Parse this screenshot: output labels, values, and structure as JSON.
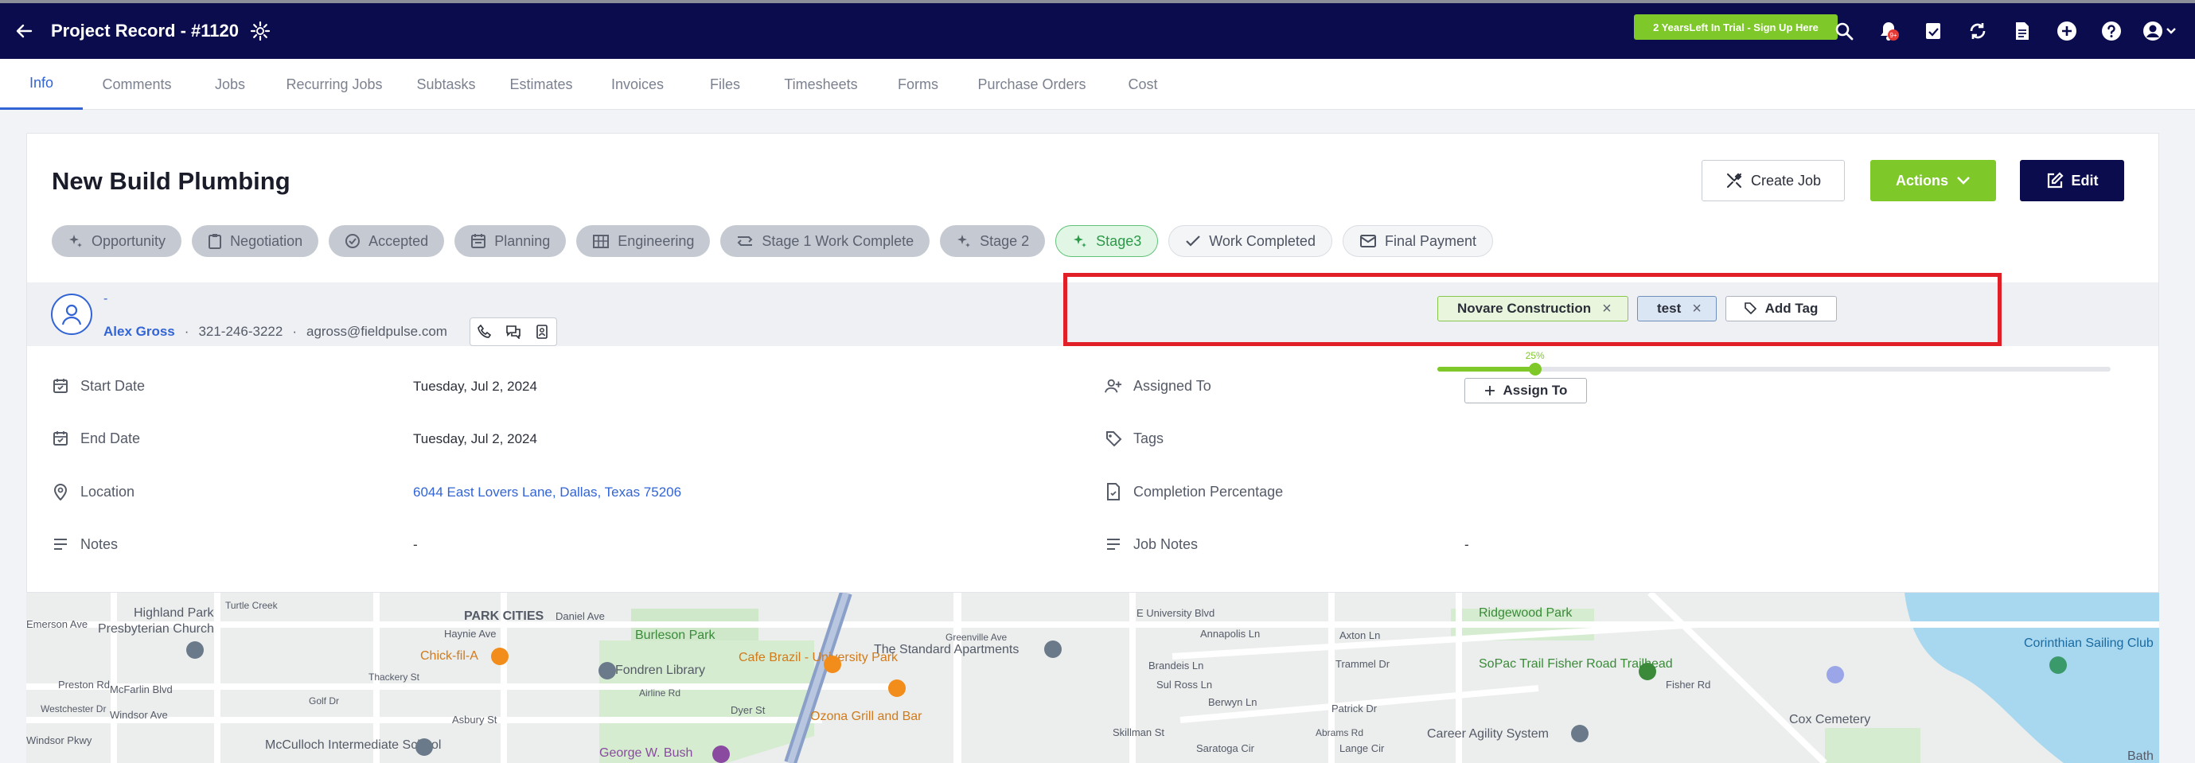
{
  "header": {
    "title": "Project Record - #1120",
    "trial_label": "2 YearsLeft In Trial - Sign Up Here",
    "notification_count": "9+"
  },
  "tabs": [
    {
      "label": "Info"
    },
    {
      "label": "Comments"
    },
    {
      "label": "Jobs"
    },
    {
      "label": "Recurring Jobs"
    },
    {
      "label": "Subtasks"
    },
    {
      "label": "Estimates"
    },
    {
      "label": "Invoices"
    },
    {
      "label": "Files"
    },
    {
      "label": "Timesheets"
    },
    {
      "label": "Forms"
    },
    {
      "label": "Purchase Orders"
    },
    {
      "label": "Cost"
    }
  ],
  "project": {
    "title": "New Build Plumbing",
    "create_job_label": "Create Job",
    "actions_label": "Actions",
    "edit_label": "Edit"
  },
  "stages": [
    {
      "label": "Opportunity"
    },
    {
      "label": "Negotiation"
    },
    {
      "label": "Accepted"
    },
    {
      "label": "Planning"
    },
    {
      "label": "Engineering"
    },
    {
      "label": "Stage 1 Work Complete"
    },
    {
      "label": "Stage 2"
    },
    {
      "label": "Stage3"
    },
    {
      "label": "Work Completed"
    },
    {
      "label": "Final Payment"
    }
  ],
  "contact": {
    "dash": "-",
    "name": "Alex Gross",
    "sep": "·",
    "phone": "321-246-3222",
    "email": "agross@fieldpulse.com"
  },
  "details": {
    "start_date_label": "Start Date",
    "start_date": "Tuesday, Jul 2, 2024",
    "end_date_label": "End Date",
    "end_date": "Tuesday, Jul 2, 2024",
    "location_label": "Location",
    "location": "6044 East Lovers Lane, Dallas, Texas 75206",
    "notes_label": "Notes",
    "notes": "-",
    "assigned_to_label": "Assigned To",
    "assign_to_button": "Assign To",
    "tags_label": "Tags",
    "tags": [
      {
        "label": "Novare Construction"
      },
      {
        "label": "test"
      }
    ],
    "add_tag_label": "Add Tag",
    "completion_label": "Completion Percentage",
    "completion_value": "25%",
    "completion_fraction": 0.145,
    "job_notes_label": "Job Notes",
    "job_notes": "-"
  },
  "map": {
    "labels": [
      {
        "text": "Highland Park"
      },
      {
        "text": "Emerson Ave"
      },
      {
        "text": "Presbyterian Church"
      },
      {
        "text": "PARK CITIES"
      },
      {
        "text": "Daniel Ave"
      },
      {
        "text": "Haynie Ave"
      },
      {
        "text": "Burleson Park"
      },
      {
        "text": "Chick-fil-A"
      },
      {
        "text": "Fondren Library"
      },
      {
        "text": "Cafe Brazil - University Park"
      },
      {
        "text": "The Standard Apartments"
      },
      {
        "text": "McFarlin Blvd"
      },
      {
        "text": "Windsor Ave"
      },
      {
        "text": "Asbury St"
      },
      {
        "text": "Dyer St"
      },
      {
        "text": "Ozona Grill and Bar"
      },
      {
        "text": "McCulloch Intermediate School"
      },
      {
        "text": "George W. Bush"
      },
      {
        "text": "Windsor Pkwy"
      },
      {
        "text": "E University Blvd"
      },
      {
        "text": "Annapolis Ln"
      },
      {
        "text": "Brandeis Ln"
      },
      {
        "text": "Sul Ross Ln"
      },
      {
        "text": "Berwyn Ln"
      },
      {
        "text": "Saratoga Cir"
      },
      {
        "text": "Skillman St"
      },
      {
        "text": "Axton Ln"
      },
      {
        "text": "Trammel Dr"
      },
      {
        "text": "Patrick Dr"
      },
      {
        "text": "Lange Cir"
      },
      {
        "text": "Ridgewood Park"
      },
      {
        "text": "SoPac Trail Fisher Road Trailhead"
      },
      {
        "text": "Career Agility System"
      },
      {
        "text": "Cox Cemetery"
      },
      {
        "text": "Corinthian Sailing Club"
      },
      {
        "text": "Fisher Rd"
      },
      {
        "text": "Preston Rd"
      },
      {
        "text": "Westchester Dr"
      },
      {
        "text": "Thackery St"
      },
      {
        "text": "Airline Rd"
      },
      {
        "text": "Golf Dr"
      },
      {
        "text": "Turtle Creek"
      },
      {
        "text": "Bath"
      },
      {
        "text": "Abrams Rd"
      },
      {
        "text": "Greenville Ave"
      }
    ]
  }
}
